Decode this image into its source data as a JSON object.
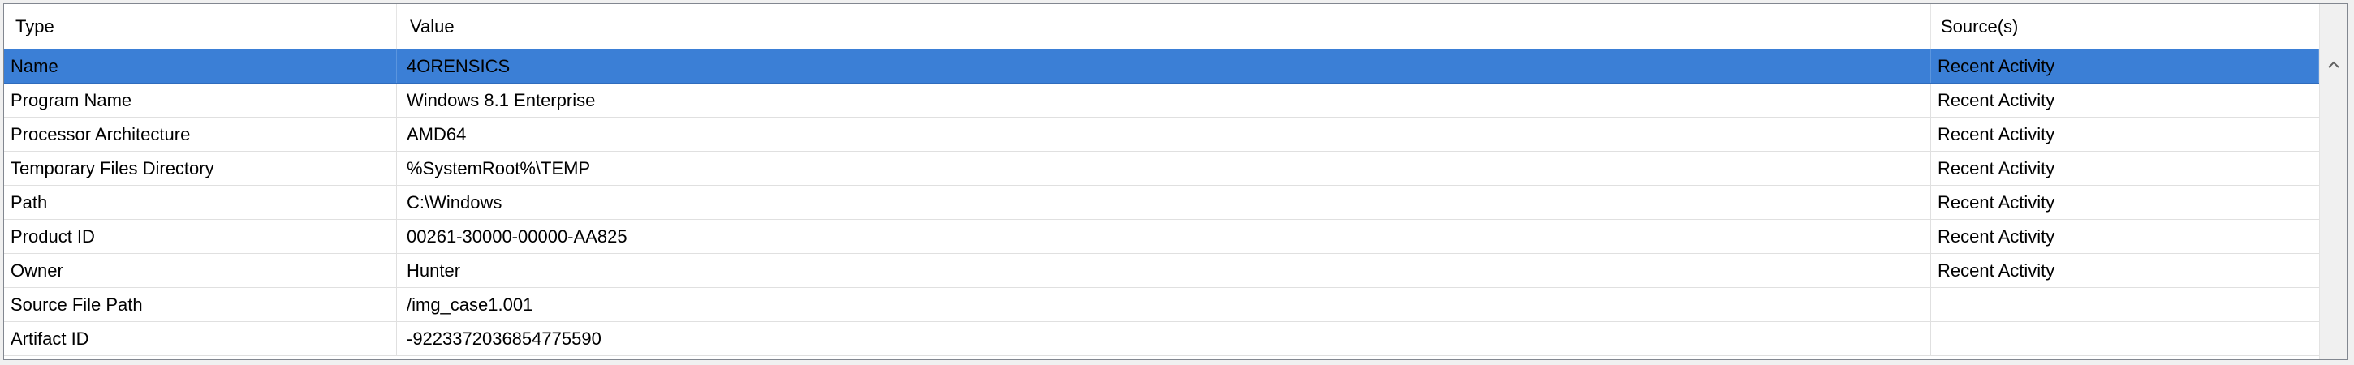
{
  "table": {
    "columns": [
      "Type",
      "Value",
      "Source(s)"
    ],
    "rows": [
      {
        "type": "Name",
        "value": "4ORENSICS",
        "source": "Recent Activity",
        "selected": true
      },
      {
        "type": "Program Name",
        "value": "Windows 8.1 Enterprise",
        "source": "Recent Activity"
      },
      {
        "type": "Processor Architecture",
        "value": "AMD64",
        "source": "Recent Activity"
      },
      {
        "type": "Temporary Files Directory",
        "value": "%SystemRoot%\\TEMP",
        "source": "Recent Activity"
      },
      {
        "type": "Path",
        "value": "C:\\Windows",
        "source": "Recent Activity"
      },
      {
        "type": "Product ID",
        "value": "00261-30000-00000-AA825",
        "source": "Recent Activity"
      },
      {
        "type": "Owner",
        "value": "Hunter",
        "source": "Recent Activity"
      },
      {
        "type": "Source File Path",
        "value": "/img_case1.001",
        "source": ""
      },
      {
        "type": "Artifact ID",
        "value": "-9223372036854775590",
        "source": ""
      }
    ]
  },
  "scrollbar": {
    "up_icon": "chevron-up-icon"
  },
  "colors": {
    "selection": "#3b7fd6",
    "border": "#828790"
  }
}
